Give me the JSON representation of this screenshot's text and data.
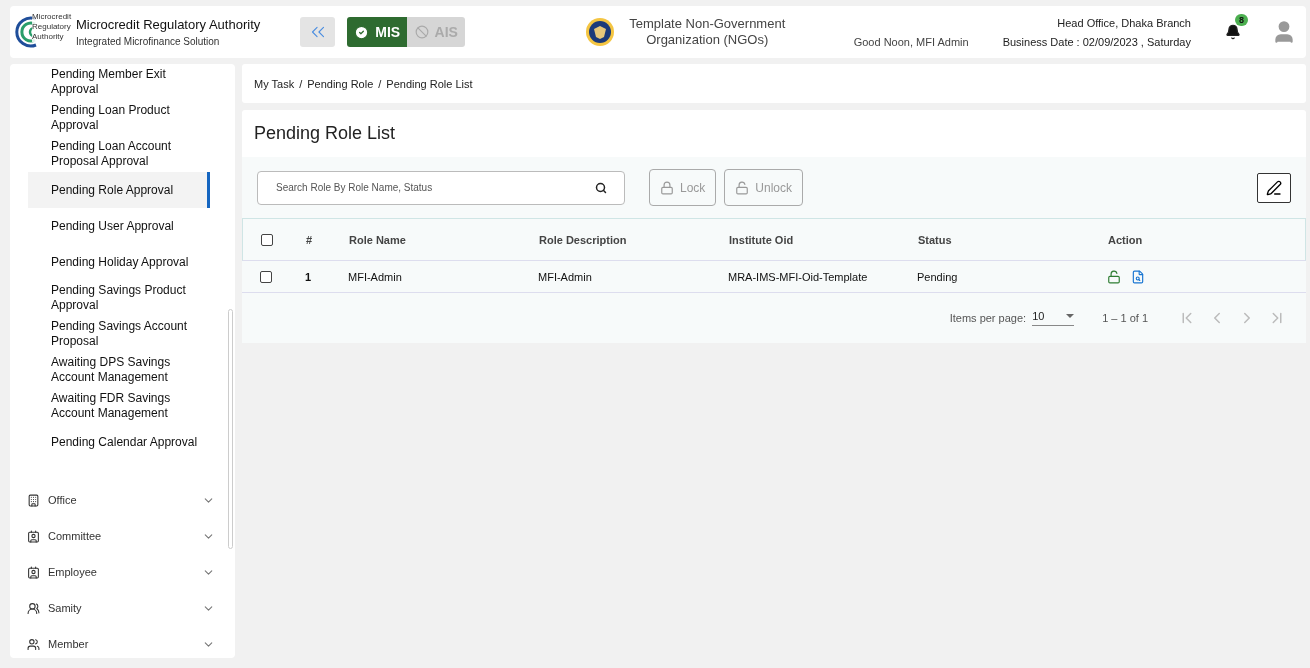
{
  "header": {
    "logo_text": [
      "Microcredit",
      "Regulatory",
      "Authority"
    ],
    "title": "Microcredit Regulatory Authority",
    "subtitle": "Integrated Microfinance Solution",
    "modes": [
      {
        "label": "MIS",
        "selected": true
      },
      {
        "label": "AIS",
        "selected": false
      }
    ],
    "organization": "Template Non-Government Organization (NGOs)",
    "greeting": "Good Noon, MFI Admin",
    "branch": "Head Office, Dhaka Branch",
    "business_date": "Business Date : 02/09/2023 , Saturday",
    "notification_count": "8"
  },
  "sidebar": {
    "sub_items": [
      {
        "label": "Pending Member Exit Approval",
        "selected": false
      },
      {
        "label": "Pending Loan Product Approval",
        "selected": false
      },
      {
        "label": "Pending Loan Account Proposal Approval",
        "selected": false
      },
      {
        "label": "Pending Role Approval",
        "selected": true
      },
      {
        "label": "Pending User Approval",
        "selected": false
      },
      {
        "label": "Pending Holiday Approval",
        "selected": false
      },
      {
        "label": "Pending Savings Product Approval",
        "selected": false
      },
      {
        "label": "Pending Savings Account Proposal",
        "selected": false
      },
      {
        "label": "Awaiting DPS Savings Account Management",
        "selected": false
      },
      {
        "label": "Awaiting FDR Savings Account Management",
        "selected": false
      },
      {
        "label": "Pending Calendar Approval",
        "selected": false
      }
    ],
    "groups": [
      {
        "label": "Office",
        "kind": "building",
        "expanded": false
      },
      {
        "label": "Committee",
        "kind": "contact",
        "expanded": false
      },
      {
        "label": "Employee",
        "kind": "contact",
        "expanded": false
      },
      {
        "label": "Samity",
        "kind": "people",
        "expanded": false
      },
      {
        "label": "Member",
        "kind": "group",
        "expanded": false
      }
    ]
  },
  "breadcrumb": [
    {
      "label": "My Task",
      "separator": "/"
    },
    {
      "label": "Pending Role",
      "separator": "/"
    },
    {
      "label": "Pending Role List"
    }
  ],
  "page_title": "Pending Role List",
  "search": {
    "placeholder": "Search Role By Role Name, Status"
  },
  "buttons": [
    {
      "label": "Lock",
      "kind": "lock",
      "disabled": true
    },
    {
      "label": "Unlock",
      "kind": "unlock",
      "disabled": true
    }
  ],
  "table": {
    "select_all_checked": false,
    "columns": [
      "#",
      "Role Name",
      "Role Description",
      "Institute Oid",
      "Status",
      "Action"
    ],
    "rows": [
      {
        "checked": false,
        "cells": [
          "1",
          "MFI-Admin",
          "MFI-Admin",
          "MRA-IMS-MFI-Oid-Template",
          "Pending"
        ]
      }
    ]
  },
  "paginator": {
    "label": "Items per page:",
    "page_size": "10",
    "range": "1 – 1 of 1"
  }
}
